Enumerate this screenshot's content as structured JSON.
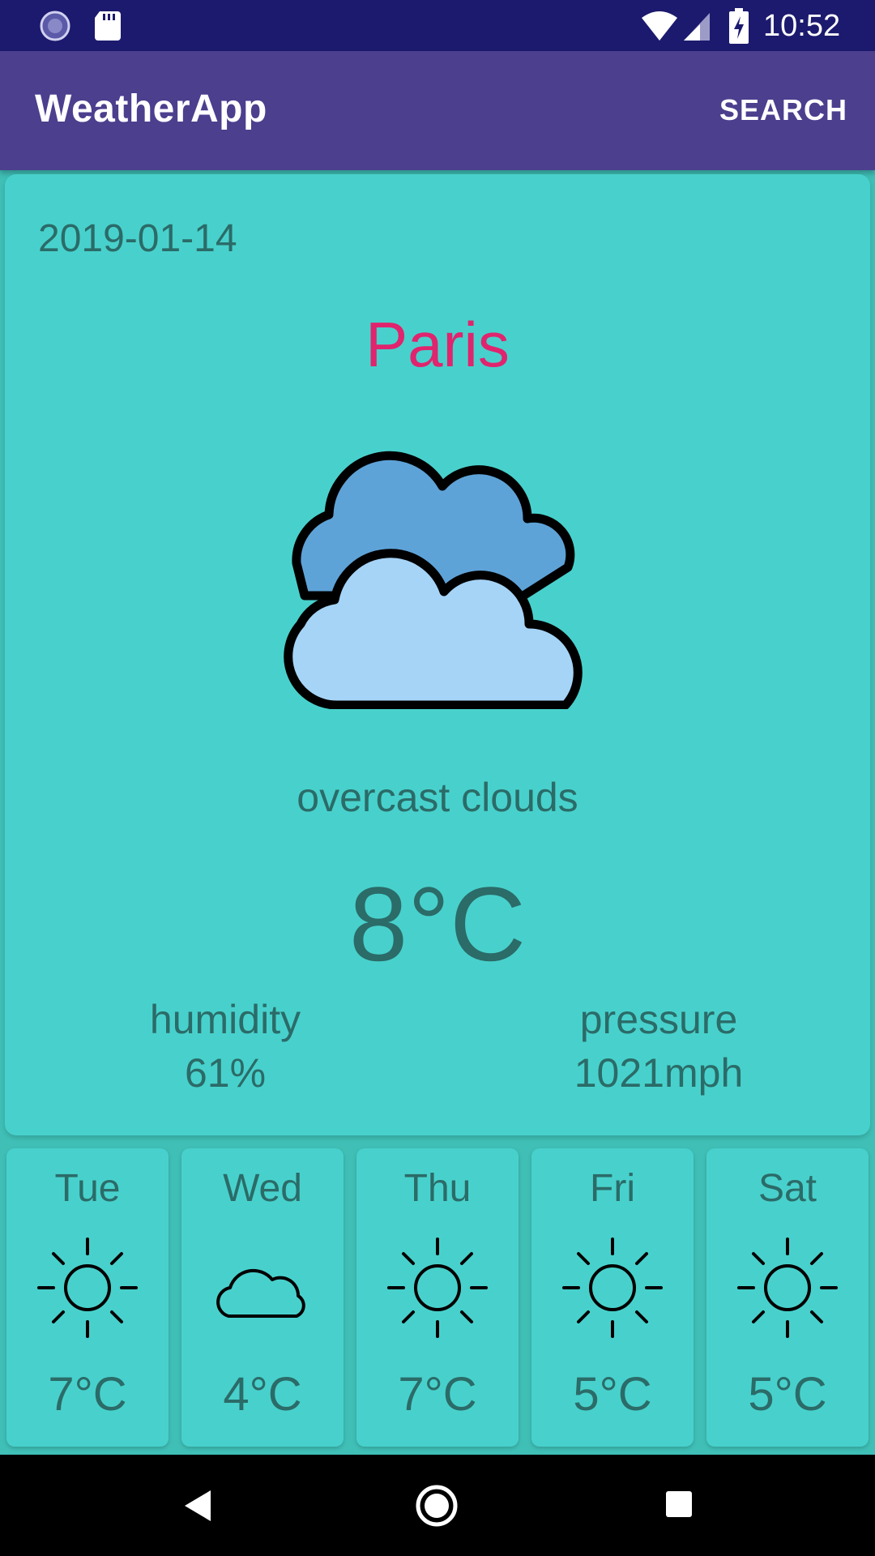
{
  "status_bar": {
    "time": "10:52",
    "icons": [
      "sync-icon",
      "sd-card-icon",
      "wifi-icon",
      "cell-signal-icon",
      "battery-charging-icon"
    ]
  },
  "app_bar": {
    "title": "WeatherApp",
    "search_label": "SEARCH"
  },
  "current": {
    "date": "2019-01-14",
    "city": "Paris",
    "icon": "overcast-clouds-icon",
    "description": "overcast clouds",
    "temperature": "8°C",
    "humidity_label": "humidity",
    "humidity_value": "61%",
    "pressure_label": "pressure",
    "pressure_value": "1021mph"
  },
  "forecast": [
    {
      "day": "Tue",
      "icon": "sun-icon",
      "temp": "7°C"
    },
    {
      "day": "Wed",
      "icon": "cloud-icon",
      "temp": "4°C"
    },
    {
      "day": "Thu",
      "icon": "sun-icon",
      "temp": "7°C"
    },
    {
      "day": "Fri",
      "icon": "sun-icon",
      "temp": "5°C"
    },
    {
      "day": "Sat",
      "icon": "sun-icon",
      "temp": "5°C"
    }
  ],
  "colors": {
    "status_bar": "#1c1a6e",
    "app_bar": "#4b3f8e",
    "card": "#48d1cc",
    "background": "#3fbfb6",
    "city": "#e0246e",
    "text": "#2b6b68"
  },
  "nav_bar": {
    "icons": [
      "back-icon",
      "home-icon",
      "recents-icon"
    ]
  }
}
